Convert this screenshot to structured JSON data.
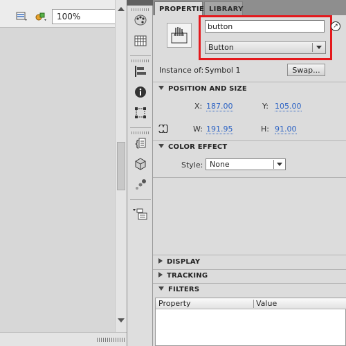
{
  "toolbar": {
    "zoom": "100%"
  },
  "tabs": [
    {
      "label": "PROPERTIES",
      "active": true
    },
    {
      "label": "LIBRARY",
      "active": false
    }
  ],
  "instance": {
    "name": "button",
    "behavior": "Button",
    "instance_of_label": "Instance of:",
    "instance_of_value": "Symbol 1",
    "swap_label": "Swap..."
  },
  "position_size": {
    "header": "POSITION AND SIZE",
    "x_label": "X:",
    "x": "187.00",
    "y_label": "Y:",
    "y": "105.00",
    "w_label": "W:",
    "w": "191.95",
    "h_label": "H:",
    "h": "91.00"
  },
  "color_effect": {
    "header": "COLOR EFFECT",
    "style_label": "Style:",
    "style_value": "None"
  },
  "sections": {
    "display": "DISPLAY",
    "tracking": "TRACKING",
    "filters": "FILTERS"
  },
  "filters_table": {
    "columns": [
      "Property",
      "Value"
    ]
  },
  "colors": {
    "highlight": "#e4181c",
    "link_value": "#2b62c4",
    "panel_bg": "#dcdcdc"
  }
}
